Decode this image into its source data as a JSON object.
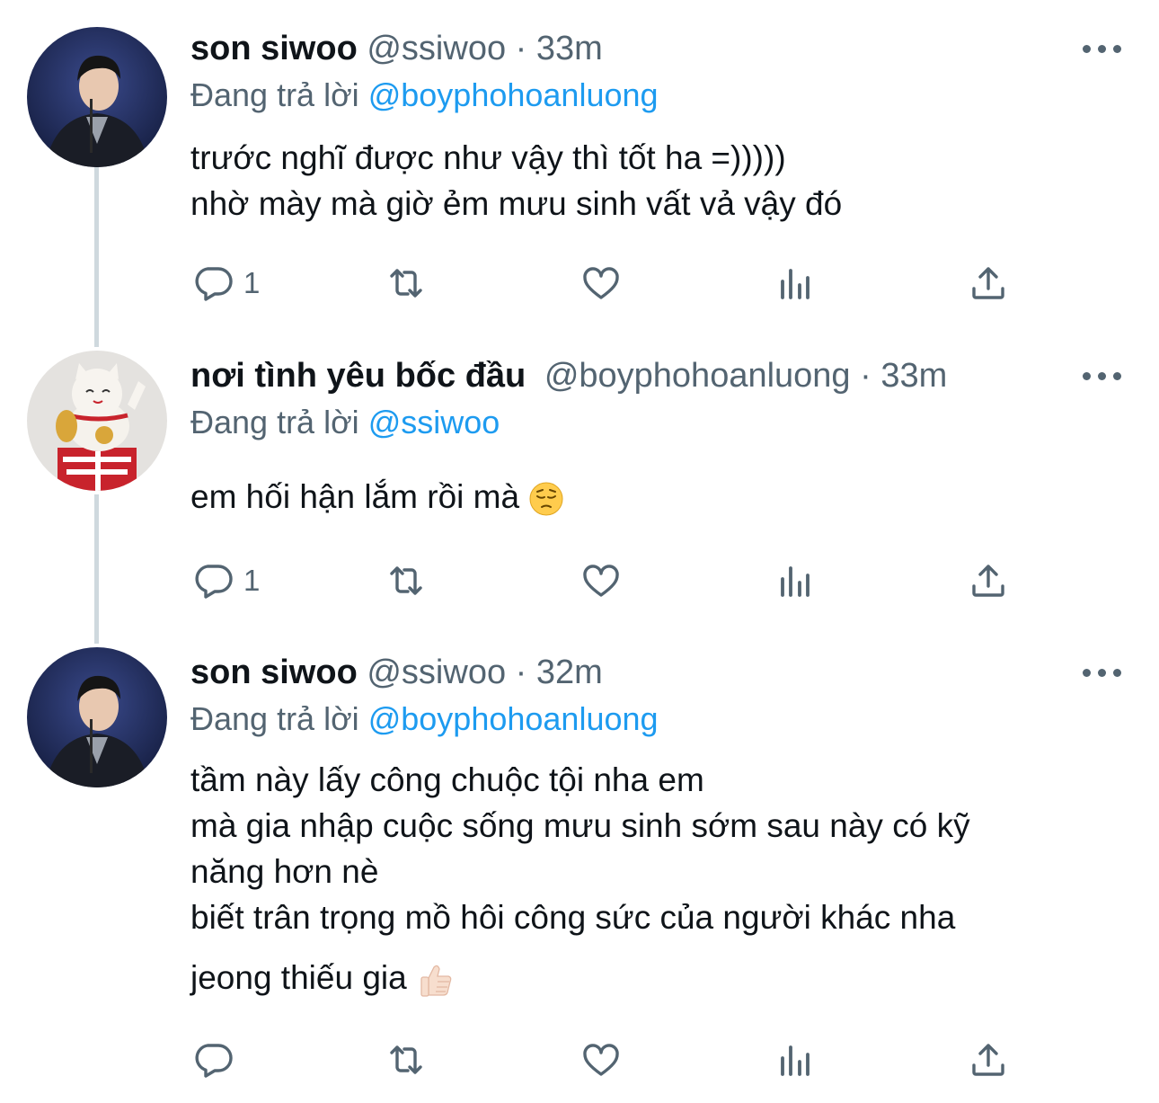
{
  "reply_prefix": "Đang trả lời",
  "tweets": [
    {
      "name": "son siwoo",
      "handle": "@ssiwoo",
      "dot": "·",
      "time": "33m",
      "reply_to": "@boyphohoanluong",
      "lines": [
        "trước nghĩ được như vậy thì tốt ha =)))))",
        "nhờ mày mà giờ ẻm mưu sinh vất vả vậy đó"
      ],
      "reply_count": "1"
    },
    {
      "name": "nơi tình yêu bốc đầu",
      "handle": "@boyphohoanluong",
      "dot": "·",
      "time": "33m",
      "reply_to": "@ssiwoo",
      "lines": [
        "em hối hận lắm rồi mà"
      ],
      "emoji": "pensive-face-emoji",
      "reply_count": "1"
    },
    {
      "name": "son siwoo",
      "handle": "@ssiwoo",
      "dot": "·",
      "time": "32m",
      "reply_to": "@boyphohoanluong",
      "lines": [
        "tầm này lấy công chuộc tội nha em",
        "mà gia nhập cuộc sống mưu sinh sớm sau này có kỹ",
        "năng hơn nè",
        "biết trân trọng mồ hôi công sức của người khác nha",
        "jeong thiếu gia"
      ],
      "emoji": "thumbs-up-emoji",
      "reply_count": ""
    }
  ],
  "icons": [
    "reply-icon",
    "retweet-icon",
    "like-icon",
    "analytics-icon",
    "share-icon",
    "more-icon"
  ],
  "colors": {
    "link": "#1d9bf0",
    "secondary_text": "#536471",
    "primary_text": "#0f1419",
    "thread_line": "#cfd9de"
  }
}
